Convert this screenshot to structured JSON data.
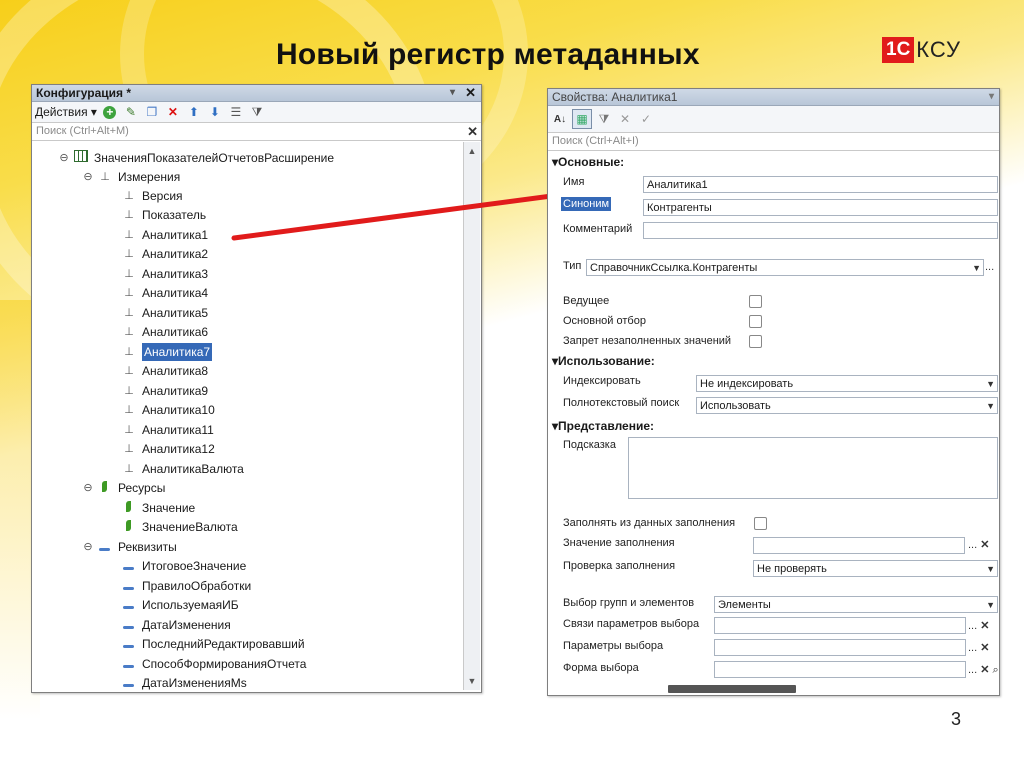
{
  "slide": {
    "title": "Новый регистр метаданных",
    "logo_red": "1С",
    "logo_text": "КСУ",
    "page_number": "3"
  },
  "config_window": {
    "title": "Конфигурация *",
    "actions_label": "Действия",
    "search_placeholder": "Поиск (Ctrl+Alt+M)",
    "root": "ЗначенияПоказателейОтчетовРасширение",
    "dimensions_group": "Измерения",
    "dimensions": [
      "Версия",
      "Показатель",
      "Аналитика1",
      "Аналитика2",
      "Аналитика3",
      "Аналитика4",
      "Аналитика5",
      "Аналитика6",
      "Аналитика7",
      "Аналитика8",
      "Аналитика9",
      "Аналитика10",
      "Аналитика11",
      "Аналитика12",
      "АналитикаВалюта"
    ],
    "selected_dimension": "Аналитика7",
    "resources_group": "Ресурсы",
    "resources": [
      "Значение",
      "ЗначениеВалюта"
    ],
    "attributes_group": "Реквизиты",
    "attributes": [
      "ИтоговоеЗначение",
      "ПравилоОбработки",
      "ИспользуемаяИБ",
      "ДатаИзменения",
      "ПоследнийРедактировавший",
      "СпособФормированияОтчета",
      "ДатаИзмененияМs"
    ]
  },
  "props_window": {
    "title": "Свойства: Аналитика1",
    "search_placeholder": "Поиск (Ctrl+Alt+I)",
    "section_main": "Основные:",
    "name_label": "Имя",
    "name_value": "Аналитика1",
    "synonym_label": "Синоним",
    "synonym_value": "Контрагенты",
    "comment_label": "Комментарий",
    "comment_value": "",
    "type_label": "Тип",
    "type_value": "СправочникСсылка.Контрагенты",
    "leading_label": "Ведущее",
    "main_filter_label": "Основной отбор",
    "deny_empty_label": "Запрет незаполненных значений",
    "section_usage": "Использование:",
    "index_label": "Индексировать",
    "index_value": "Не индексировать",
    "fulltext_label": "Полнотекстовый поиск",
    "fulltext_value": "Использовать",
    "section_presentation": "Представление:",
    "hint_label": "Подсказка",
    "fill_from_label": "Заполнять из данных заполнения",
    "fill_value_label": "Значение заполнения",
    "fill_check_label": "Проверка заполнения",
    "fill_check_value": "Не проверять",
    "choice_groups_label": "Выбор групп и элементов",
    "choice_groups_value": "Элементы",
    "choice_links_label": "Связи параметров выбора",
    "choice_params_label": "Параметры выбора",
    "choice_form_label": "Форма выбора"
  },
  "colors": {
    "accent_red": "#e11b1b",
    "selection_blue": "#3569b7",
    "background_yellow": "#f7cf1a"
  }
}
